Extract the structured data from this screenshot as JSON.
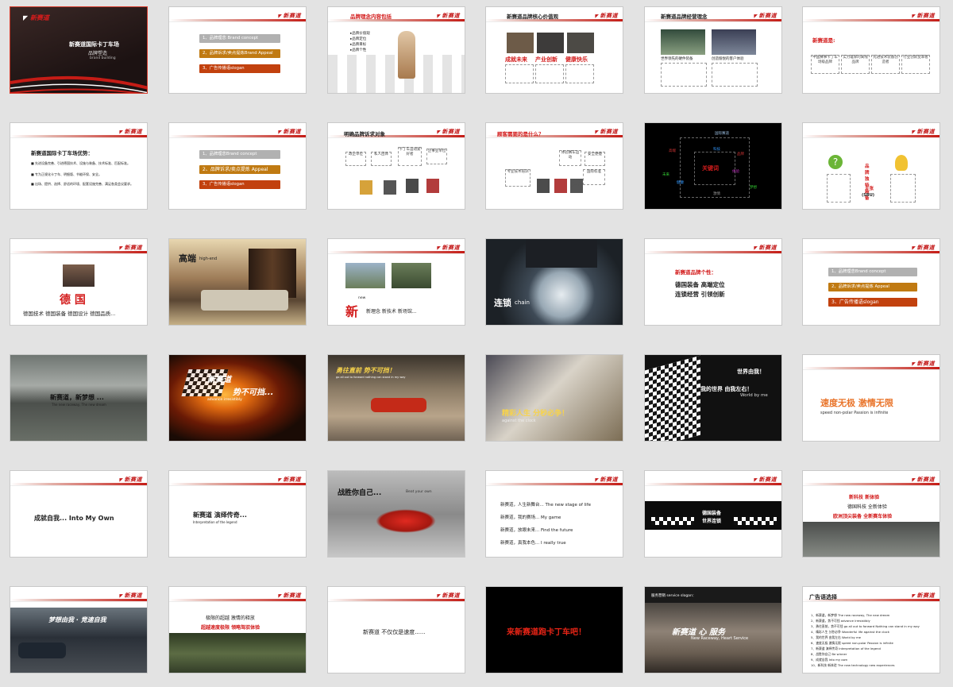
{
  "brand": {
    "logo_text": "新赛道",
    "accent": "#d31c1c"
  },
  "slides": {
    "s1": {
      "title": "新赛道国际卡丁车场",
      "subtitle": "品牌塑造",
      "caption": "brand building"
    },
    "s2": {
      "items": [
        "1、品牌理念 Brand concept",
        "2、品牌诉求/卖点提炼Brand Appeal",
        "3、广告传播语slogan"
      ]
    },
    "s3": {
      "title": "品牌理念内容包括",
      "bullets": [
        "▸品牌价值观",
        "▸品牌定位",
        "▸品牌目标",
        "▸品牌个性"
      ]
    },
    "s4": {
      "title": "新赛道品牌核心价值观",
      "labels": [
        "成就未来",
        "产业创新",
        "健康快乐"
      ]
    },
    "s5": {
      "title": "新赛道品牌经营理念",
      "labels": [
        "世界领先的硬件装备",
        "创造愉悦的客户体验"
      ]
    },
    "s6": {
      "title": "新赛道是:",
      "boxes": [
        "中国赛事卡丁车场级品牌",
        "实力雄厚的离线品牌",
        "先进技术装备创造者",
        "行业创新变革者"
      ]
    },
    "s7": {
      "title": "新赛道国际卡丁车场优势：",
      "bullets": [
        "■ 先进设备完善、引进德国技术、设施与装备、技术标准、匹配标准。",
        "■ 专为正规化卡丁车、明细版、节能环保、安全。",
        "■ 出场、提供、选择、舒适的环境、配套设施完善、满足各类会议要求。"
      ]
    },
    "s8": {
      "items": [
        "1、品牌理念Brand concept",
        "2、品牌诉求/卖点提炼 Appeal",
        "3、广告传播语slogan"
      ]
    },
    "s9": {
      "title": "明确品牌诉求对象",
      "bubbles": [
        "政企单位",
        "私人团体",
        "卡丁车运动爱好者",
        "企事业单位"
      ]
    },
    "s10": {
      "title": "顾客需要的是什么？",
      "bubbles": [
        "专业技术培训",
        "体验赛车运动",
        "国际标准",
        "安全便捷"
      ]
    },
    "s11": {
      "center": "关键词",
      "words": [
        "国际赛道",
        "高端",
        "品牌",
        "体验",
        "梦想",
        "未来",
        "健康",
        "科技",
        "激情"
      ]
    },
    "s12": {
      "labels": [
        "品牌独特装备",
        "主张",
        "(SBU)"
      ]
    },
    "s13": {
      "title": "德  国",
      "caption": "德国技术  德国装备  德国设计  德国品质..."
    },
    "s14": {
      "title": "高端",
      "subtitle": "high-end"
    },
    "s15": {
      "title": "新",
      "small": "new",
      "caption": "新理念 新技术 新场馆..."
    },
    "s16": {
      "title": "连锁",
      "subtitle": "chain"
    },
    "s17": {
      "title": "新赛道品牌个性：",
      "lines": [
        "德国装备  高端定位",
        "连锁经营  引领创新"
      ]
    },
    "s18": {
      "items": [
        "1、品牌理念Brand concept",
        "2、品牌诉求/卖点提炼 Appeal",
        "3、广告传播语slogan"
      ]
    },
    "s19": {
      "title": "新赛道，新梦想 ...",
      "subtitle": "The new raceway, The new dream"
    },
    "s20": {
      "title": "新赛道",
      "title2": "势不可挡...",
      "subtitle": "advance irresistibly"
    },
    "s21": {
      "title": "勇往直前  势不可挡！",
      "subtitle": "go all out to forward  nothing can stand in my way"
    },
    "s22": {
      "title": "精彩人生  分秒必争！",
      "subtitle": "against the clock"
    },
    "s23": {
      "line1": "世界由我！",
      "line2": "我的世界  由我左右！",
      "line3": "World by me"
    },
    "s24": {
      "title": "速度无极    激情无限",
      "subtitle": "speed  non-polar     Passion is infinite"
    },
    "s25": {
      "title": "成就自我...  Into My Own"
    },
    "s26": {
      "title": "新赛道  演绎传奇...",
      "subtitle": "Interpretation of the legend"
    },
    "s27": {
      "title": "战胜你自己...",
      "subtitle": "Beat your own"
    },
    "s28": {
      "lines": [
        "新赛道，人生新舞台...   The new stage of life",
        "新赛道，我的赛场...    My game",
        "新赛道，放眼未来...   Find the future",
        "新赛道，真我本色...   I really true"
      ]
    },
    "s29": {
      "line1": "德国装备",
      "line2": "世界连锁"
    },
    "s30": {
      "line1": "新科技  新体验",
      "line2": "德国科技  全新体验",
      "line3": "欧洲顶尖装备  全新赛车体验"
    },
    "s31": {
      "title": "梦想由我  ·  竞速自我"
    },
    "s32": {
      "line1": "极限的超越  激情的释放",
      "line2": "超越速度极限  领略驾驭体验"
    },
    "s33": {
      "title": "新赛道  不仅仅是速度......"
    },
    "s34": {
      "title": "来新赛道跑卡丁车吧！"
    },
    "s35": {
      "header": "服务营销 service slogan：",
      "title": "新赛道  心  服务",
      "subtitle": "New Raceway, Heart Service"
    },
    "s36": {
      "title": "广告语选择",
      "items": [
        "1、新赛道，新梦想    The new raceway,  The new dream",
        "2、新赛道，势不可挡  advance irresistibly",
        "3、勇往直前，势不可挡  go all out to forward  Nothing can stand in my way",
        "4、精彩人生 分秒必争  Wonderful life   against the clock",
        "5、我的世界 由我左右  World by me",
        "6、速度无极 激情无限  speed  non-polar   Passion is infinite",
        "7、新赛道 演绎传奇  Interpretation of the legend",
        "8、战胜你自己  Be winner",
        "9、成就自我  Into my own",
        "10、新科技 新体验  The new technology new experiences"
      ]
    }
  }
}
